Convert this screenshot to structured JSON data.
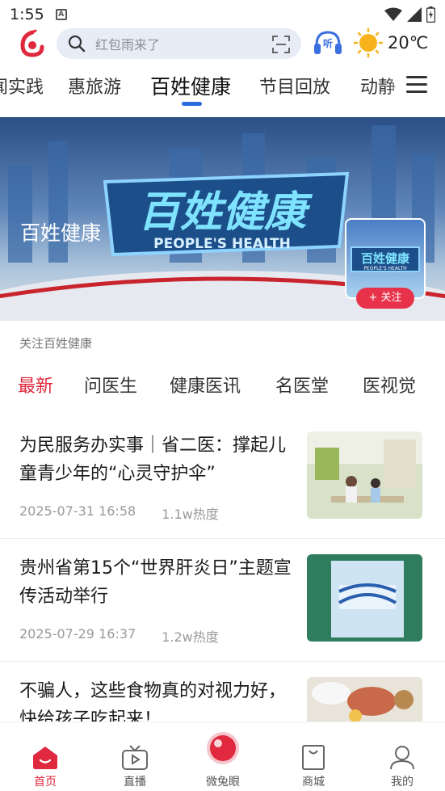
{
  "status_bar": {
    "time": "1:55"
  },
  "header": {
    "search_placeholder": "红包雨来了",
    "listen_label": "听",
    "temperature": "20℃"
  },
  "channel_tabs": [
    "闻实践",
    "惠旅游",
    "百姓健康",
    "节目回放",
    "动静"
  ],
  "active_channel": "百姓健康",
  "banner": {
    "title": "百姓健康",
    "follow_label": "+ 关注"
  },
  "sub_caption": "关注百姓健康",
  "sub_tabs": [
    "最新",
    "问医生",
    "健康医讯",
    "名医堂",
    "医视觉"
  ],
  "news": [
    {
      "title": "为民服务办实事｜省二医：撑起儿童青少年的“心灵守护伞”",
      "date": "2025-07-31 16:58",
      "heat": "1.1w热度"
    },
    {
      "title": "贵州省第15个“世界肝炎日”主题宣传活动举行",
      "date": "2025-07-29 16:37",
      "heat": "1.2w热度"
    },
    {
      "title": "不骗人，这些食物真的对视力好，快给孩子吃起来！",
      "date": "",
      "heat": ""
    }
  ],
  "bottom_nav": [
    "首页",
    "直播",
    "微兔眼",
    "商城",
    "我的"
  ],
  "colors": {
    "accent_red": "#e0283e",
    "tab_blue": "#2b6be0",
    "search_bg": "#e8ecf7"
  }
}
